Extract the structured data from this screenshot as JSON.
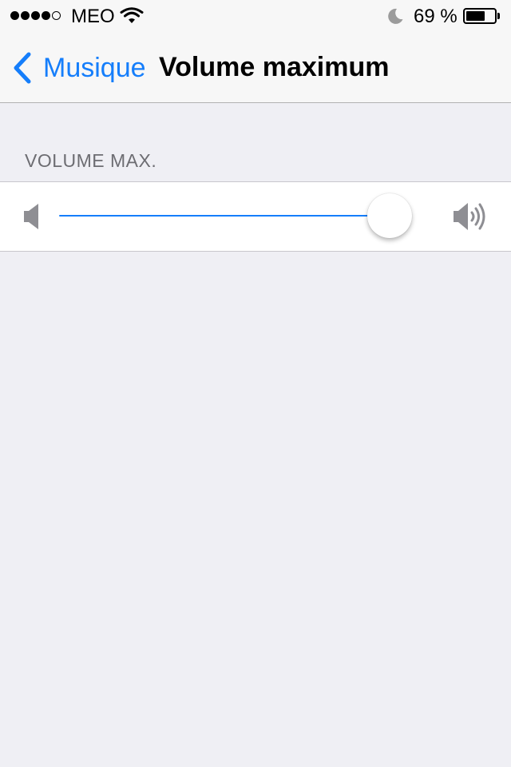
{
  "status_bar": {
    "carrier": "MEO",
    "signal_bars_filled": 4,
    "signal_bars_total": 5,
    "battery_percent_label": "69 %",
    "icons": [
      "wifi-icon",
      "moon-icon",
      "battery-icon"
    ]
  },
  "nav": {
    "back_label": "Musique",
    "title": "Volume maximum"
  },
  "section": {
    "header": "VOLUME MAX."
  },
  "slider": {
    "value": 1.0,
    "min_icon": "speaker-min-icon",
    "max_icon": "speaker-max-icon"
  },
  "colors": {
    "accent": "#157efb",
    "background": "#efeff4",
    "section_header": "#6d6d72"
  }
}
